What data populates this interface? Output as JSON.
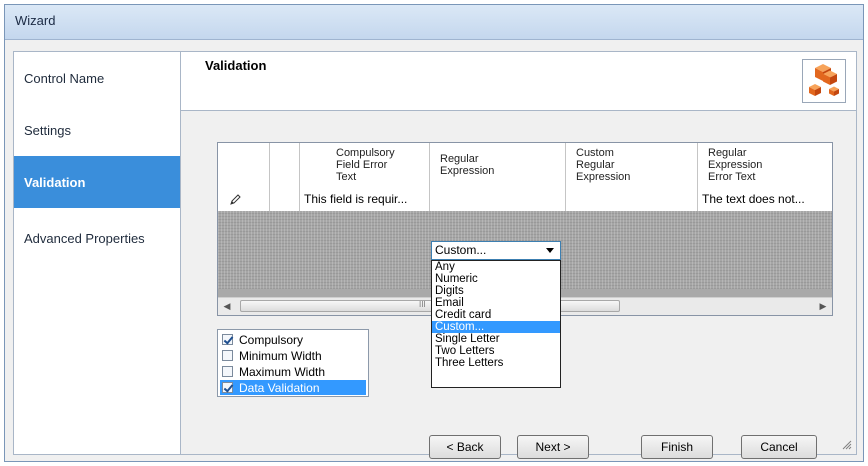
{
  "window": {
    "title": "Wizard"
  },
  "sidebar": {
    "items": [
      {
        "label": "Control Name",
        "active": false
      },
      {
        "label": "Settings",
        "active": false
      },
      {
        "label": "Validation",
        "active": true
      },
      {
        "label": "Advanced Properties",
        "active": false
      }
    ]
  },
  "page": {
    "title": "Validation",
    "logo_icon": "cubes-icon"
  },
  "grid": {
    "columns": [
      {
        "label": ""
      },
      {
        "label": ""
      },
      {
        "label": "Compulsory\nField Error\nText"
      },
      {
        "label": "Regular\nExpression"
      },
      {
        "label": "Custom\nRegular\nExpression"
      },
      {
        "label": "Regular\nExpression\nError Text"
      }
    ],
    "row": {
      "edit_icon": "pencil-icon",
      "compulsory_error": "This field is requir...",
      "regular_expression": "Custom...",
      "custom_regex": "",
      "regex_error": "The text does not..."
    },
    "scroll_marker": "III"
  },
  "regex_dropdown": {
    "selected": "Custom...",
    "options": [
      "Any",
      "Numeric",
      "Digits",
      "Email",
      "Credit card",
      "Custom...",
      "Single Letter",
      "Two Letters",
      "Three Letters"
    ]
  },
  "checklist": {
    "items": [
      {
        "label": "Compulsory",
        "checked": true,
        "highlighted": false
      },
      {
        "label": "Minimum Width",
        "checked": false,
        "highlighted": false
      },
      {
        "label": "Maximum Width",
        "checked": false,
        "highlighted": false
      },
      {
        "label": "Data Validation",
        "checked": true,
        "highlighted": true
      }
    ]
  },
  "buttons": {
    "back": "< Back",
    "next": "Next >",
    "finish": "Finish",
    "cancel": "Cancel"
  },
  "colors": {
    "accent": "#3a8edb",
    "selection": "#3399ff"
  }
}
